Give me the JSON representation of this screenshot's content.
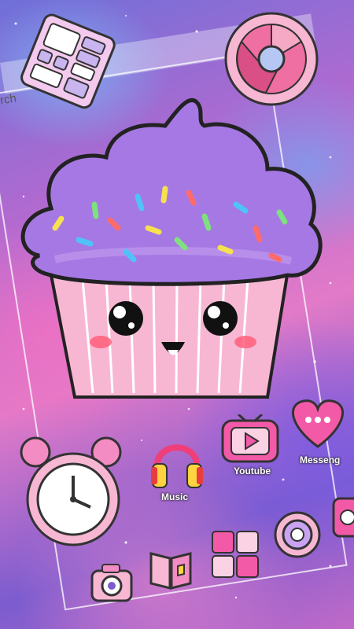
{
  "search": {
    "placeholder_fragment": "rch"
  },
  "apps": [
    {
      "name": "music-app",
      "label": "Music",
      "icon": "headphones-icon"
    },
    {
      "name": "youtube-app",
      "label": "Youtube",
      "icon": "play-tv-icon"
    },
    {
      "name": "messenger-app",
      "label": "Messeng",
      "icon": "chat-heart-icon"
    }
  ],
  "dock_icons": [
    "calculator-icon",
    "browser-icon",
    "alarm-clock-icon",
    "camera-icon",
    "contacts-book-icon",
    "gallery-icon",
    "settings-icon",
    "phone-icon"
  ],
  "colors": {
    "pink": "#f25aa8",
    "purple": "#7b5ccf",
    "cupcake_liner": "#f7b7d3",
    "frosting": "#a678e4"
  }
}
